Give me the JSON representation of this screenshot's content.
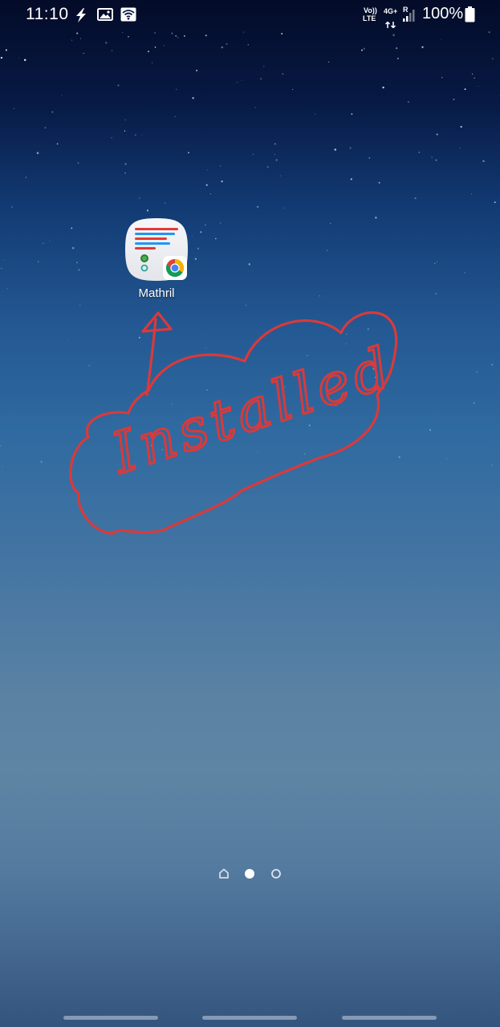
{
  "status_bar": {
    "time": "11:10",
    "network_volte": "Vo))",
    "network_lte": "LTE",
    "network_4g": "4G+",
    "roaming": "R",
    "battery_percent": "100%",
    "battery_level": 1.0,
    "icons": [
      "flash-icon",
      "gallery-icon",
      "wifi-icon",
      "signal-icon",
      "battery-icon"
    ]
  },
  "home": {
    "app": {
      "label": "Mathril",
      "icon": "mathril-app-icon",
      "badge_icon": "chrome-badge-icon"
    },
    "annotation": {
      "text": "Installed",
      "color": "#d93a3a"
    },
    "page_indicator": {
      "pages": [
        "home-page",
        "page-2",
        "page-3"
      ],
      "current_index": 1
    }
  },
  "colors": {
    "annotation_red": "#d93a3a",
    "text": "#ffffff"
  }
}
